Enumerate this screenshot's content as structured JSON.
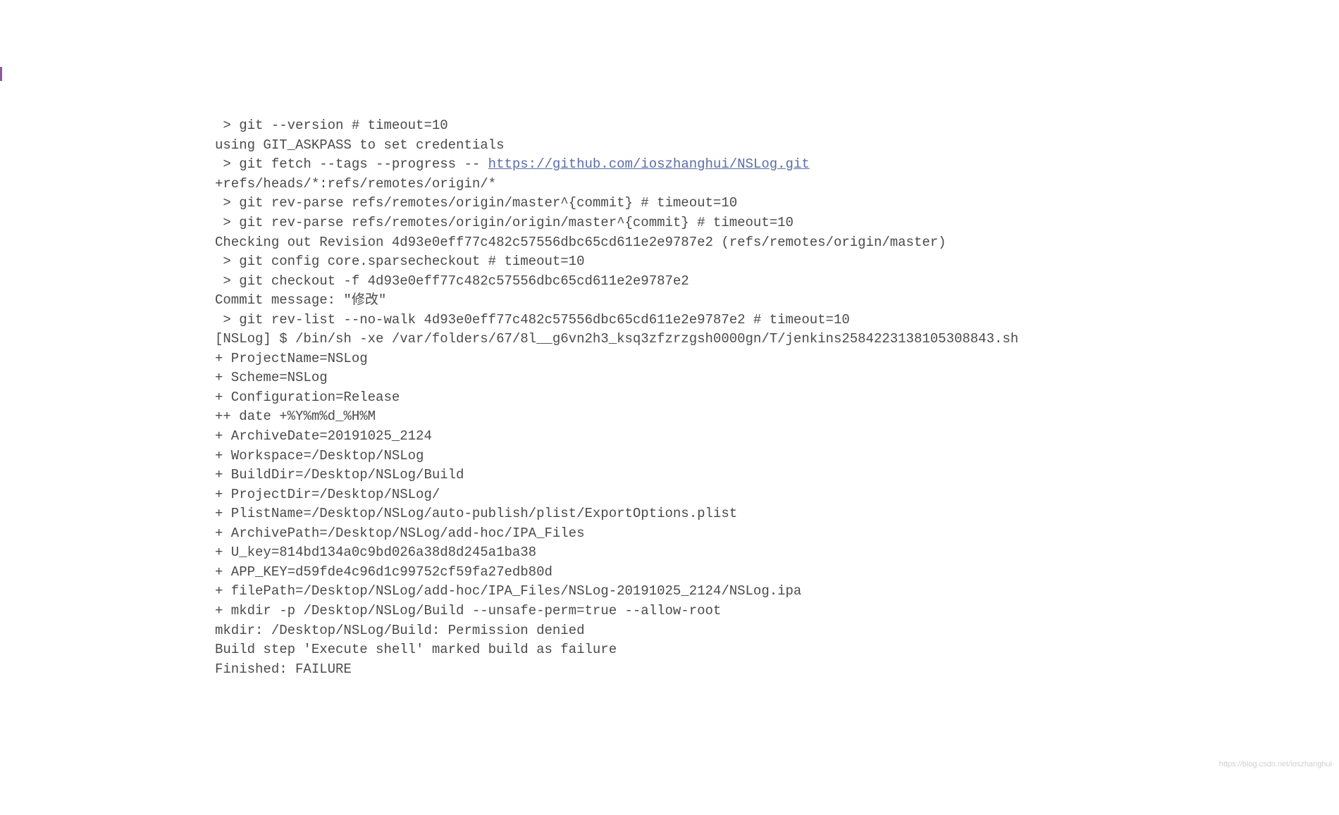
{
  "console": {
    "lines": [
      {
        "text": " > git --version # timeout=10"
      },
      {
        "text": "using GIT_ASKPASS to set credentials "
      },
      {
        "prefix": " > git fetch --tags --progress -- ",
        "link": "https://github.com/ioszhanghui/NSLog.git",
        "suffix": ""
      },
      {
        "text": "+refs/heads/*:refs/remotes/origin/*"
      },
      {
        "text": " > git rev-parse refs/remotes/origin/master^{commit} # timeout=10"
      },
      {
        "text": " > git rev-parse refs/remotes/origin/origin/master^{commit} # timeout=10"
      },
      {
        "text": "Checking out Revision 4d93e0eff77c482c57556dbc65cd611e2e9787e2 (refs/remotes/origin/master)"
      },
      {
        "text": " > git config core.sparsecheckout # timeout=10"
      },
      {
        "text": " > git checkout -f 4d93e0eff77c482c57556dbc65cd611e2e9787e2"
      },
      {
        "text": "Commit message: \"修改\""
      },
      {
        "text": " > git rev-list --no-walk 4d93e0eff77c482c57556dbc65cd611e2e9787e2 # timeout=10"
      },
      {
        "text": "[NSLog] $ /bin/sh -xe /var/folders/67/8l__g6vn2h3_ksq3zfzrzgsh0000gn/T/jenkins2584223138105308843.sh"
      },
      {
        "text": "+ ProjectName=NSLog"
      },
      {
        "text": "+ Scheme=NSLog"
      },
      {
        "text": "+ Configuration=Release"
      },
      {
        "text": "++ date +%Y%m%d_%H%M"
      },
      {
        "text": "+ ArchiveDate=20191025_2124"
      },
      {
        "text": "+ Workspace=/Desktop/NSLog"
      },
      {
        "text": "+ BuildDir=/Desktop/NSLog/Build"
      },
      {
        "text": "+ ProjectDir=/Desktop/NSLog/"
      },
      {
        "text": "+ PlistName=/Desktop/NSLog/auto-publish/plist/ExportOptions.plist"
      },
      {
        "text": "+ ArchivePath=/Desktop/NSLog/add-hoc/IPA_Files"
      },
      {
        "text": "+ U_key=814bd134a0c9bd026a38d8d245a1ba38"
      },
      {
        "text": "+ APP_KEY=d59fde4c96d1c99752cf59fa27edb80d"
      },
      {
        "text": "+ filePath=/Desktop/NSLog/add-hoc/IPA_Files/NSLog-20191025_2124/NSLog.ipa"
      },
      {
        "text": "+ mkdir -p /Desktop/NSLog/Build --unsafe-perm=true --allow-root"
      },
      {
        "text": "mkdir: /Desktop/NSLog/Build: Permission denied"
      },
      {
        "text": "Build step 'Execute shell' marked build as failure"
      },
      {
        "text": "Finished: FAILURE"
      }
    ]
  },
  "watermark": "https://blog.csdn.net/ioszhanghui"
}
